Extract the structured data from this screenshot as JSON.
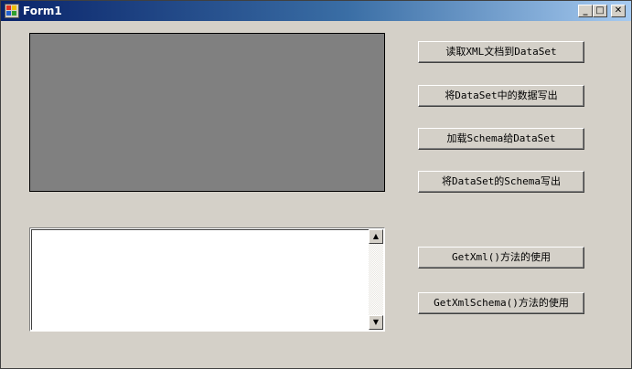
{
  "window": {
    "title": "Form1",
    "minimize_glyph": "_",
    "maximize_glyph": "□",
    "close_glyph": "✕"
  },
  "buttons": {
    "read_xml": "读取XML文档到DataSet",
    "write_data": "将DataSet中的数据写出",
    "load_schema": "加载Schema给DataSet",
    "write_schema": "将DataSet的Schema写出",
    "get_xml": "GetXml()方法的使用",
    "get_xml_schema": "GetXmlSchema()方法的使用"
  },
  "scrollbar": {
    "up_glyph": "▲",
    "down_glyph": "▼"
  }
}
